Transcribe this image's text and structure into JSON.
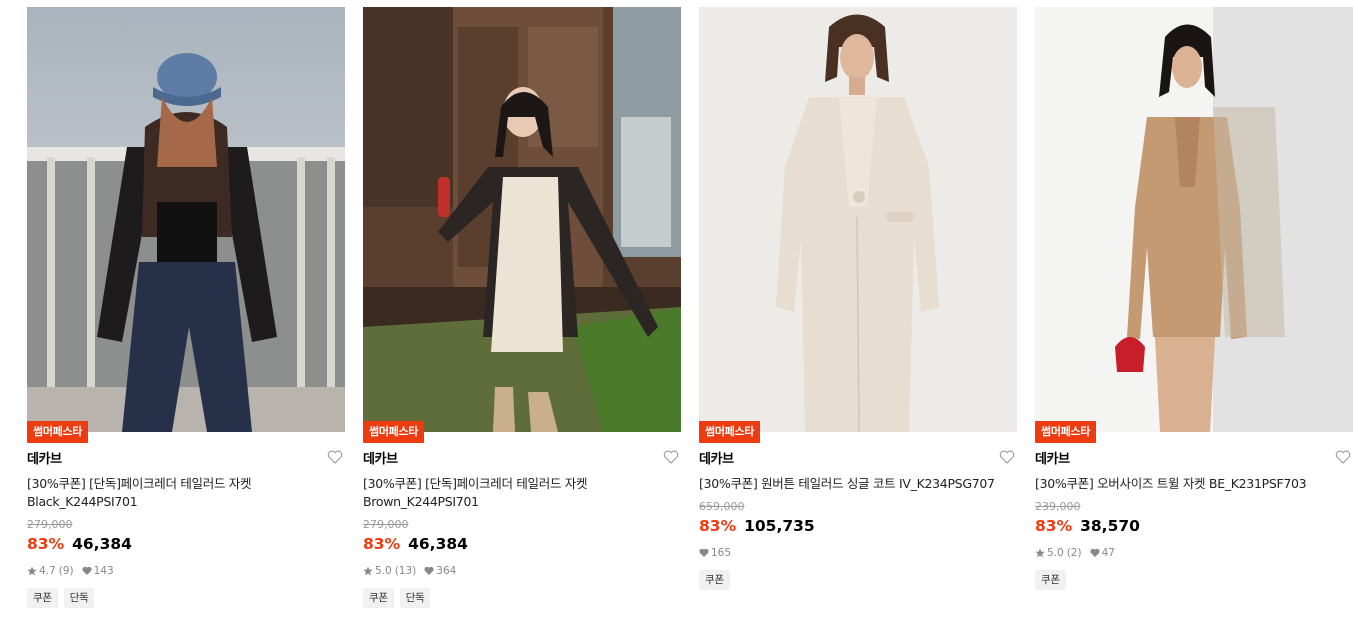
{
  "colors": {
    "accent": "#ee3c12",
    "muted": "#9a9a9a"
  },
  "icons": {
    "wishlist": "heart-outline-icon",
    "rating": "star-icon",
    "likes": "heart-filled-icon"
  },
  "products": [
    {
      "badge": "썸머페스타",
      "brand": "데카브",
      "title": "[30%쿠폰] [단독]페이크레더 테일러드 자켓 Black_K244PSI701",
      "original_price": "279,000",
      "discount": "83%",
      "price": "46,384",
      "rating": "4.7",
      "reviews": "(9)",
      "likes": "143",
      "tags": [
        "쿠폰",
        "단독"
      ]
    },
    {
      "badge": "썸머페스타",
      "brand": "데카브",
      "title": "[30%쿠폰] [단독]페이크레더 테일러드 자켓 Brown_K244PSI701",
      "original_price": "279,000",
      "discount": "83%",
      "price": "46,384",
      "rating": "5.0",
      "reviews": "(13)",
      "likes": "364",
      "tags": [
        "쿠폰",
        "단독"
      ]
    },
    {
      "badge": "썸머페스타",
      "brand": "데카브",
      "title": "[30%쿠폰] 원버튼 테일러드 싱글 코트 IV_K234PSG707",
      "original_price": "659,000",
      "discount": "83%",
      "price": "105,735",
      "rating": "",
      "reviews": "",
      "likes": "165",
      "tags": [
        "쿠폰"
      ]
    },
    {
      "badge": "썸머페스타",
      "brand": "데카브",
      "title": "[30%쿠폰] 오버사이즈 트윌 자켓 BE_K231PSF703",
      "original_price": "239,000",
      "discount": "83%",
      "price": "38,570",
      "rating": "5.0",
      "reviews": "(2)",
      "likes": "47",
      "tags": [
        "쿠폰"
      ]
    }
  ]
}
